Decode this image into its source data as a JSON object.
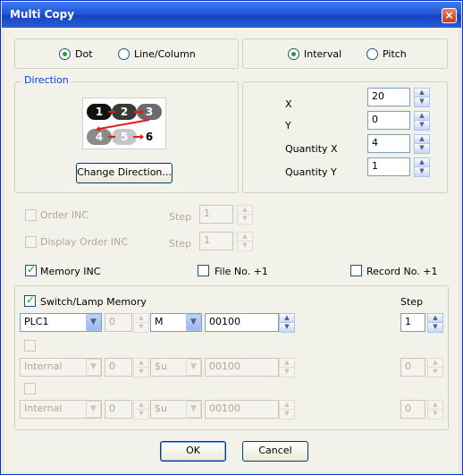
{
  "window": {
    "title": "Multi Copy",
    "close_glyph": "×"
  },
  "mode": {
    "dot": "Dot",
    "line_column": "Line/Column",
    "selected": "Dot"
  },
  "spacing": {
    "interval": "Interval",
    "pitch": "Pitch",
    "selected": "Interval"
  },
  "direction": {
    "group_label": "Direction",
    "nodes": [
      "1",
      "2",
      "3",
      "4",
      "5",
      "6"
    ],
    "change_button": "Change Direction..."
  },
  "params": [
    {
      "label": "X",
      "value": "20"
    },
    {
      "label": "Y",
      "value": "0"
    },
    {
      "label": "Quantity X",
      "value": "4"
    },
    {
      "label": "Quantity Y",
      "value": "1"
    }
  ],
  "order_inc": {
    "label": "Order INC",
    "step_label": "Step",
    "step_value": "1"
  },
  "display_order_inc": {
    "label": "Display Order INC",
    "step_label": "Step",
    "step_value": "1"
  },
  "memory_inc": {
    "label": "Memory INC",
    "checked": true
  },
  "file_no": {
    "label": "File No. +1",
    "checked": false
  },
  "record_no": {
    "label": "Record No. +1",
    "checked": false
  },
  "switch_lamp": {
    "label": "Switch/Lamp Memory",
    "step_header": "Step",
    "rows": [
      {
        "enabled": true,
        "plc": "PLC1",
        "station": "0",
        "device": "M",
        "address": "00100",
        "step": "1"
      },
      {
        "enabled": false,
        "plc": "Internal",
        "station": "0",
        "device": "$u",
        "address": "00100",
        "step": "0"
      },
      {
        "enabled": false,
        "plc": "Internal",
        "station": "0",
        "device": "$u",
        "address": "00100",
        "step": "0"
      }
    ]
  },
  "buttons": {
    "ok": "OK",
    "cancel": "Cancel"
  },
  "colors": {
    "titlebar": "#245edb",
    "accent_check": "#21a121",
    "disabled_text": "#aca899"
  }
}
